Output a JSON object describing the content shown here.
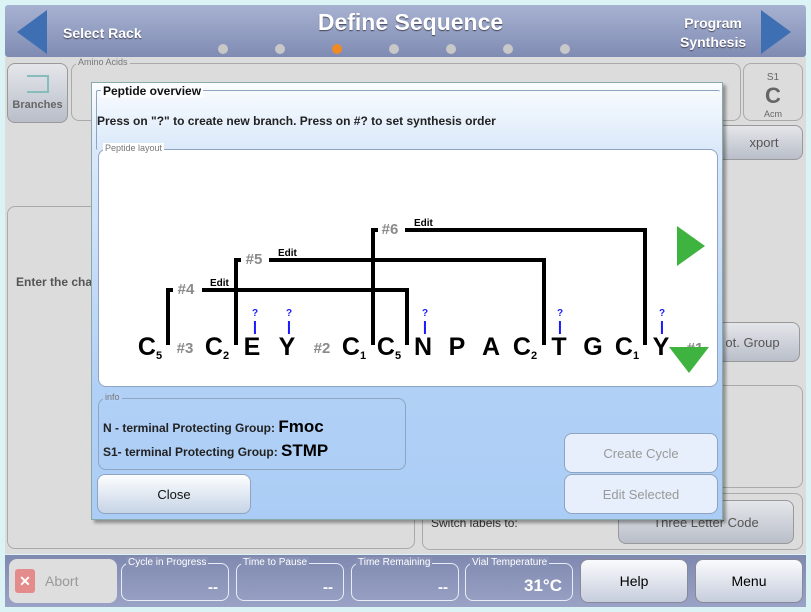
{
  "header": {
    "title": "Define Sequence",
    "back_label": "Select Rack",
    "next_label_line1": "Program",
    "next_label_line2": "Synthesis",
    "steps": 7,
    "active_step": 3,
    "accent": "#f08a24"
  },
  "background": {
    "branches_label": "Branches",
    "amino_acids_legend": "Amino Acids",
    "s1_label": "S1",
    "s1_residue": "C",
    "s1_group": "Acm",
    "export_label": "xport",
    "enter_chain_label": "Enter the cha",
    "prot_group_label": "ot. Group",
    "switch_labels_label": "Switch labels to:",
    "three_letter_label": "Three Letter Code"
  },
  "dialog": {
    "title": "Peptide overview",
    "instruction": "Press on \"?\" to create new branch. Press on #? to set synthesis order",
    "layout_legend": "Peptide layout",
    "residues": [
      {
        "letter": "C",
        "sub": "5"
      },
      {
        "letter": "C",
        "sub": "2"
      },
      {
        "letter": "E",
        "sub": ""
      },
      {
        "letter": "Y",
        "sub": ""
      },
      {
        "letter": "C",
        "sub": "1"
      },
      {
        "letter": "C",
        "sub": "5"
      },
      {
        "letter": "N",
        "sub": ""
      },
      {
        "letter": "P",
        "sub": ""
      },
      {
        "letter": "A",
        "sub": ""
      },
      {
        "letter": "C",
        "sub": "2"
      },
      {
        "letter": "T",
        "sub": ""
      },
      {
        "letter": "G",
        "sub": ""
      },
      {
        "letter": "C",
        "sub": "1"
      },
      {
        "letter": "Y",
        "sub": ""
      }
    ],
    "chain_labels": [
      "#3",
      "#2",
      "#1"
    ],
    "branches": [
      {
        "label": "#4",
        "edit": "Edit"
      },
      {
        "label": "#5",
        "edit": "Edit"
      },
      {
        "label": "#6",
        "edit": "Edit"
      }
    ],
    "branch_marker": "?",
    "info_legend": "info",
    "n_term_label": "N - terminal Protecting Group:",
    "n_term_value": "Fmoc",
    "s1_term_label": "S1- terminal Protecting Group:",
    "s1_term_value": "STMP",
    "close_label": "Close",
    "create_cycle_label": "Create Cycle",
    "edit_selected_label": "Edit Selected"
  },
  "footer": {
    "abort_label": "Abort",
    "cycle_legend": "Cycle in Progress",
    "cycle_value": "--",
    "pause_legend": "Time to Pause",
    "pause_value": "--",
    "remaining_legend": "Time Remaining",
    "remaining_value": "--",
    "temp_legend": "Vial Temperature",
    "temp_value": "31°C",
    "help_label": "Help",
    "menu_label": "Menu"
  }
}
